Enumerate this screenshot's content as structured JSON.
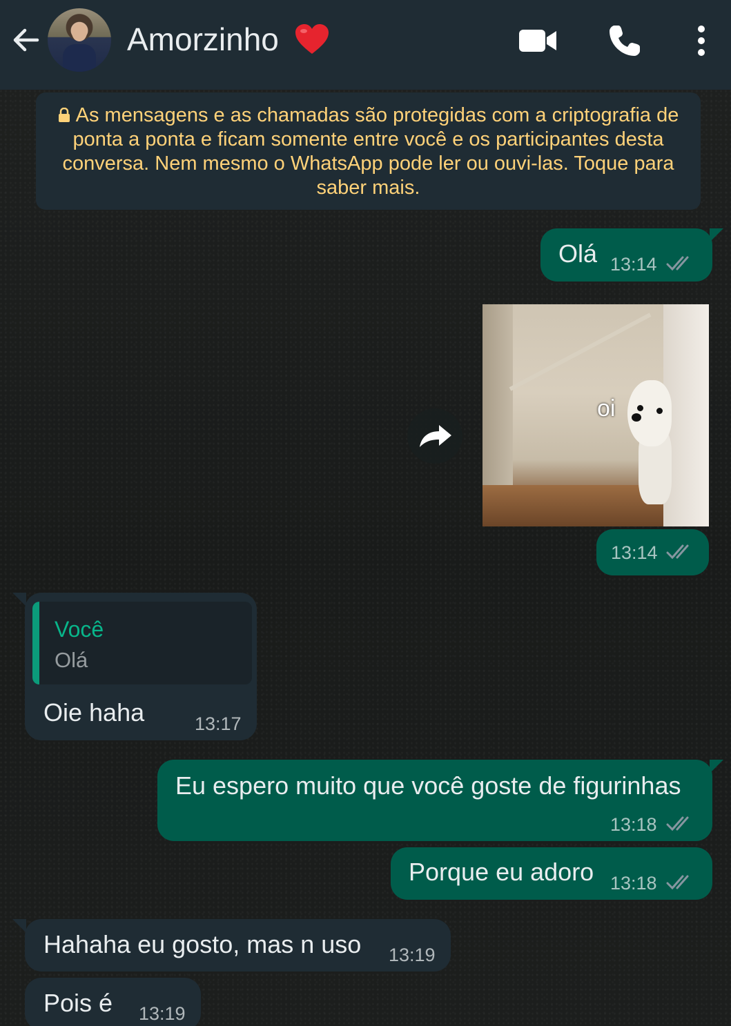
{
  "header": {
    "contact_name": "Amorzinho",
    "icons": [
      "back-arrow-icon",
      "avatar",
      "heart-icon",
      "video-call-icon",
      "phone-icon",
      "more-options-icon"
    ]
  },
  "encryption_notice": {
    "text": "As mensagens e as chamadas são protegidas com a criptografia de ponta a ponta e ficam somente entre você e os participantes desta conversa. Nem mesmo o WhatsApp pode ler ou ouvi-las. Toque para saber mais."
  },
  "messages": [
    {
      "direction": "out",
      "text": "Olá",
      "time": "13:14",
      "status": "read"
    },
    {
      "direction": "out",
      "type": "sticker",
      "sticker_text": "oi",
      "time": "13:14",
      "status": "read"
    },
    {
      "direction": "in",
      "reply_to": {
        "author": "Você",
        "text": "Olá"
      },
      "text": "Oie haha",
      "time": "13:17"
    },
    {
      "direction": "out",
      "text": "Eu espero muito que você goste de figurinhas",
      "time": "13:18",
      "status": "read"
    },
    {
      "direction": "out",
      "text": "Porque eu adoro",
      "time": "13:18",
      "status": "read"
    },
    {
      "direction": "in",
      "text": "Hahaha eu gosto, mas n uso",
      "time": "13:19"
    },
    {
      "direction": "in",
      "text": "Pois é",
      "time": "13:19"
    }
  ],
  "colors": {
    "header_bg": "#1f2c34",
    "outgoing_bubble": "#005c4b",
    "incoming_bubble": "#1f2c34",
    "notice_text": "#ffd279",
    "quote_accent": "#06cf9c",
    "read_ticks": "#8696a0"
  }
}
